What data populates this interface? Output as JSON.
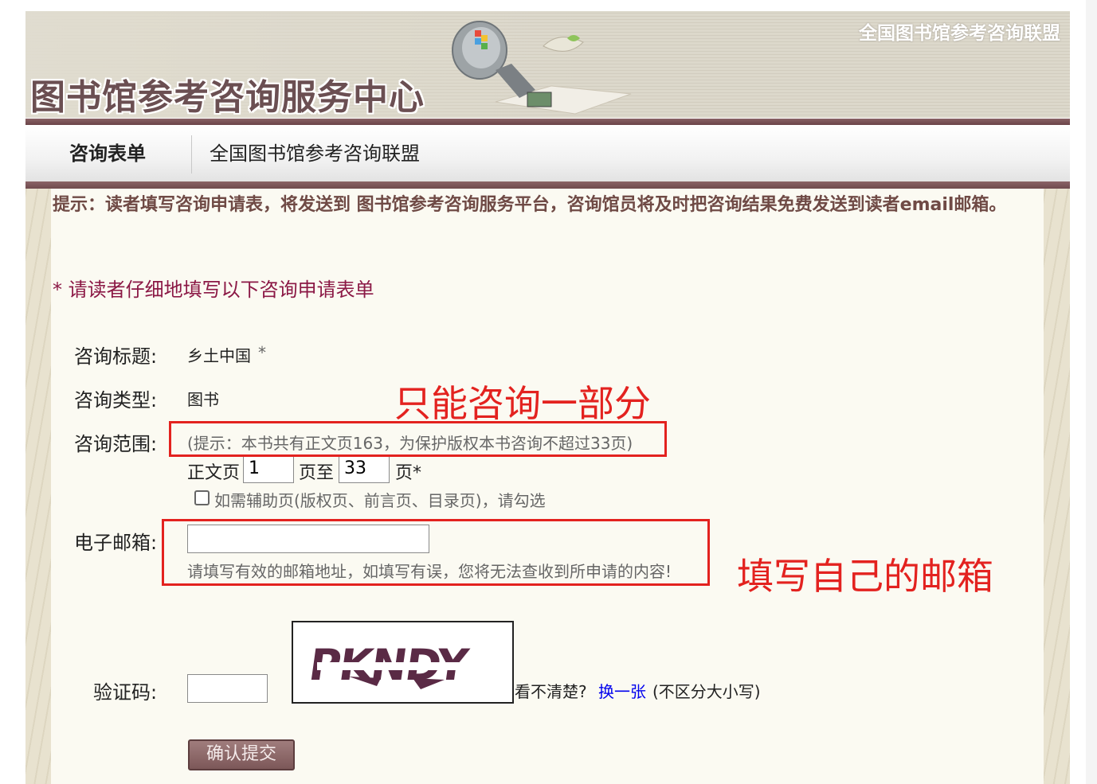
{
  "header": {
    "site_title": "图书馆参考咨询服务中心",
    "top_right_link": "全国图书馆参考咨询联盟"
  },
  "nav": {
    "tabs": [
      {
        "label": "咨询表单",
        "active": true
      },
      {
        "label": "全国图书馆参考咨询联盟",
        "active": false
      }
    ]
  },
  "notice": {
    "hint": "提示：读者填写咨询申请表，将发送到 图书馆参考咨询服务平台，咨询馆员将及时把咨询结果免费发送到读者email邮箱。",
    "required_note": "*  请读者仔细地填写以下咨询申请表单"
  },
  "form": {
    "title_label": "咨询标题:",
    "title_value": "乡土中国",
    "title_required": "*",
    "type_label": "咨询类型:",
    "type_value": "图书",
    "range_label": "咨询范围:",
    "range_hint": "(提示：本书共有正文页163，为保护版权本书咨询不超过33页)",
    "page_prefix": "正文页",
    "page_from": "1",
    "page_mid": "页至",
    "page_to": "33",
    "page_suffix": "页*",
    "aux_checkbox_label": "如需辅助页(版权页、前言页、目录页)，请勾选",
    "email_label": "电子邮箱:",
    "email_value": "",
    "email_hint": "请填写有效的邮箱地址，如填写有误，您将无法查收到所申请的内容!",
    "captcha_label": "验证码:",
    "captcha_value": "",
    "captcha_text": "PKNDY",
    "captcha_unclear": "看不清楚?",
    "captcha_refresh": "换一张",
    "captcha_case_note": "(不区分大小写)",
    "submit_label": "确认提交"
  },
  "annotations": {
    "range_note": "只能咨询一部分",
    "email_note": "填写自己的邮箱"
  },
  "colors": {
    "accent_maroon": "#6f4a45",
    "required_red": "#8b1845",
    "annotation_red": "#e3221f",
    "link_blue": "#0000ee"
  }
}
